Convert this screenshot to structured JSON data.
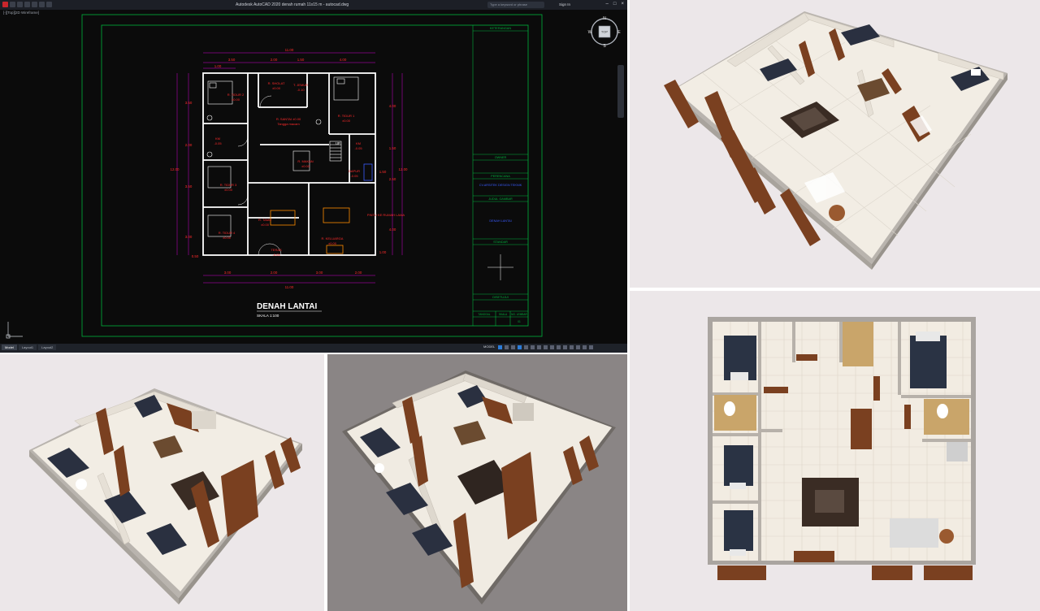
{
  "app": {
    "title": "Autodesk AutoCAD 2020   denah rumah 11x15 m - autocad.dwg",
    "search_placeholder": "Type a keyword or phrase",
    "user": "Sign In",
    "view_label": "[-][Top][2D Wireframe]"
  },
  "cad": {
    "drawing_title": "DENAH LANTAI",
    "scale": "SKALA 1:100",
    "rooms": {
      "r_tidur2": "R. TIDUR 2",
      "r_tidur2_elev": "±0.00",
      "r_sholat": "R. SHOLAT",
      "r_sholat_elev": "±0.00",
      "r_jemur": "T. JEMUR",
      "r_jemur_elev": "-0.10",
      "r_tidur1": "R. TIDUR 1",
      "r_tidur1_elev": "±0.00",
      "r_santai": "R. SANTAI ±0.00",
      "r_santai_sub": "Tangga macam",
      "km1": "KM",
      "km1_elev": "-0.05",
      "km2": "KM",
      "km2_elev": "-0.05",
      "r_makan": "R. MAKAN",
      "r_makan_elev": "±0.00",
      "dapur": "DAPUR",
      "dapur_elev": "-0.05",
      "r_tidur3": "R. TIDUR 3",
      "r_tidur3_elev": "±0.00",
      "r_tamu": "R. TAMU",
      "r_tamu_elev": "±0.00",
      "r_keluarga": "R. KELUARGA",
      "r_keluarga_elev": "±0.00",
      "r_tidur4": "R. TIDUR 4",
      "r_tidur4_elev": "±0.00",
      "teras": "TERAS",
      "teras_elev": "-0.05",
      "pintu": "PINTU KE RUMAH LAMA",
      "up": "UP"
    },
    "dims": {
      "top_total": "11.00",
      "top_a": "3.50",
      "top_b": "2.00",
      "top_c": "1.50",
      "top_d": "4.00",
      "top_e": "1.00",
      "bottom_total": "11.00",
      "bottom_a": "3.00",
      "bottom_b": "2.00",
      "bottom_c": "3.00",
      "bottom_d": "2.00",
      "left_total": "12.00",
      "left_a": "3.50",
      "left_b": "2.00",
      "left_c": "3.50",
      "left_d": "3.00",
      "left_e": "0.50",
      "right_total": "12.00",
      "right_a": "4.00",
      "right_b": "1.50",
      "right_c": "2.50",
      "right_d": "4.00",
      "right_e": "1.00",
      "right_f": "1.50"
    },
    "title_block": {
      "keterangan": "KETERANGAN",
      "owner": "OWNER",
      "perencana": "PERENCANA",
      "perencana_name": "CV.ARSITEK DESIGN TEKNIK",
      "judul_gambar": "JUDUL GAMBAR",
      "judul_value": "DENAH LANTAI",
      "standar": "STANDAR",
      "disetujui": "DISETUJUI",
      "col_tanggal": "TANGGAL",
      "col_skala": "SKALA",
      "col_no": "NO. LEMBAR",
      "no_value": "01"
    },
    "nav": {
      "n": "N",
      "s": "S",
      "e": "E",
      "w": "W",
      "top": "TOP"
    },
    "status": {
      "tab_model": "Model",
      "tab_layout1": "Layout1",
      "tab_layout2": "Layout2",
      "model": "MODEL"
    }
  },
  "colors": {
    "cad_bg": "#0b0b0b",
    "walls": "#ffffff",
    "frame": "#00b23c",
    "dims": "#ff2b2b",
    "dim_lines": "#d000d0",
    "blue_text": "#3a5cff",
    "view_bg": "#ece7e9",
    "floor": "#f3eee6",
    "wood": "#7a4020",
    "bed": "#2a3040",
    "sofa": "#3a2c24"
  },
  "icons": [
    "autocad-logo",
    "compass-icon",
    "view-cube-icon",
    "ucs-axis-icon"
  ]
}
